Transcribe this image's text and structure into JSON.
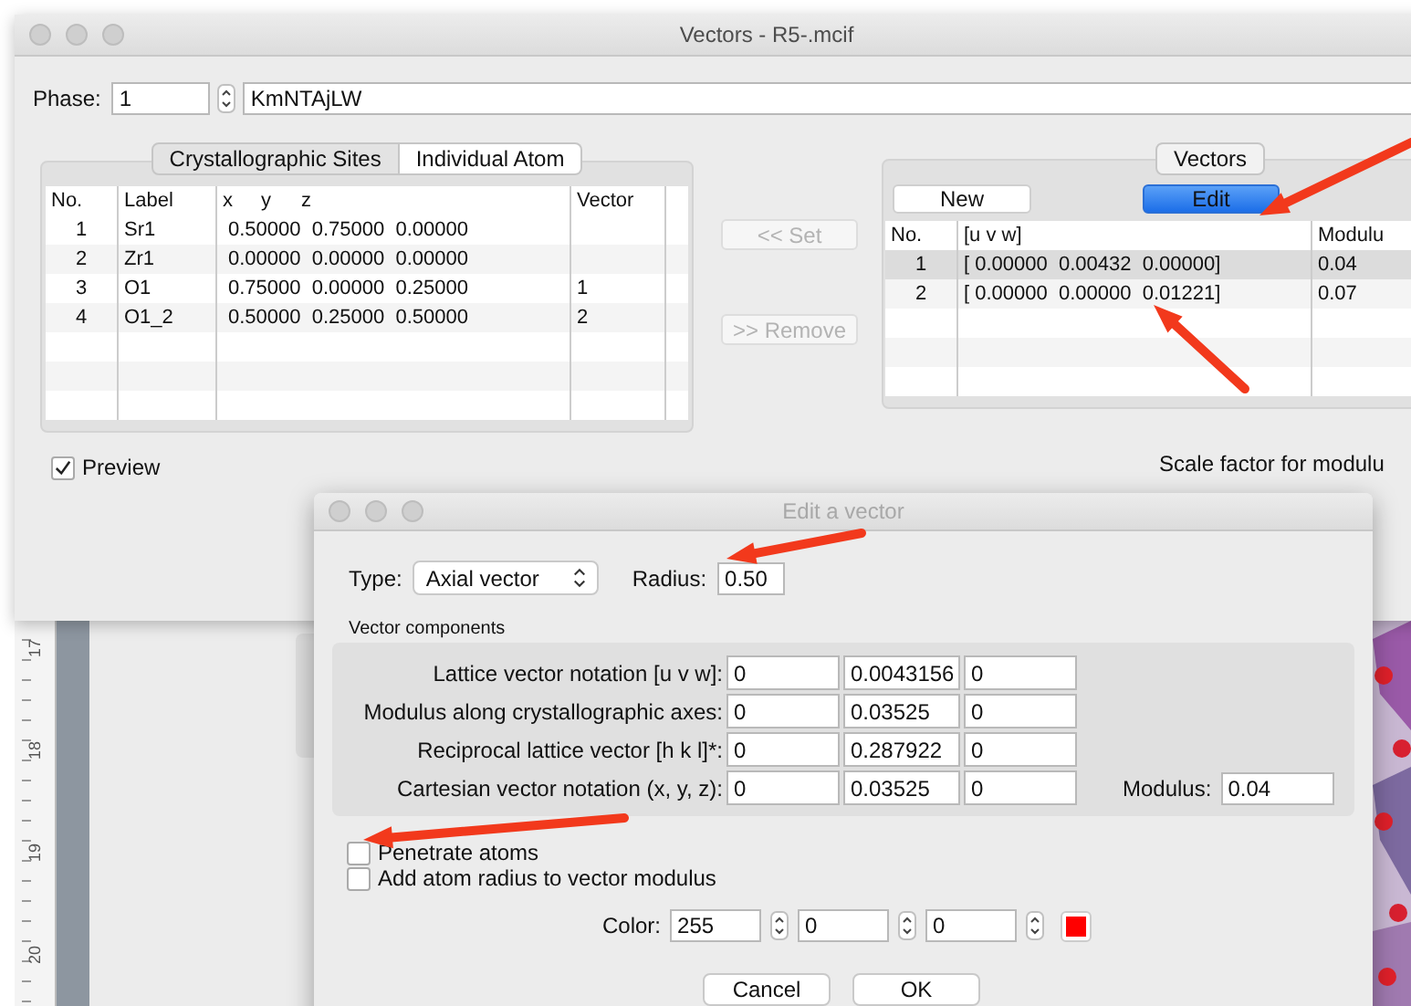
{
  "main_window": {
    "title": "Vectors - R5-.mcif",
    "phase": {
      "label": "Phase:",
      "value": "1",
      "name": "KmNTAjLW"
    },
    "tabs": [
      {
        "label": "Crystallographic Sites",
        "selected": false
      },
      {
        "label": "Individual Atom",
        "selected": true
      }
    ],
    "sites_table": {
      "columns": [
        "No.",
        "Label",
        "x",
        "y",
        "z",
        "Vector"
      ],
      "rows": [
        {
          "no": "1",
          "label": "Sr1",
          "xyz": "0.50000  0.75000  0.00000"
        },
        {
          "no": "2",
          "label": "Zr1",
          "xyz": "0.00000  0.00000  0.00000"
        },
        {
          "no": "3",
          "label": "O1",
          "xyz": "0.75000  0.00000  0.25000",
          "vector": "1"
        },
        {
          "no": "4",
          "label": "O1_2",
          "xyz": "0.50000  0.25000  0.50000",
          "vector": "2"
        }
      ]
    },
    "preview": {
      "label": "Preview",
      "checked": true
    },
    "side_buttons": [
      {
        "label": "<< Set",
        "disabled": true
      },
      {
        "label": ">> Remove",
        "disabled": true
      }
    ],
    "vectors": {
      "tab": "Vectors",
      "buttons": [
        {
          "label": "New",
          "default": false
        },
        {
          "label": "Edit",
          "default": true
        }
      ],
      "columns": [
        "No.",
        "[u v w]",
        "Modulu"
      ],
      "rows": [
        {
          "no": "1",
          "uvw": "[ 0.00000  0.00432  0.00000]",
          "modulus": "0.04",
          "selected": true
        },
        {
          "no": "2",
          "uvw": "[ 0.00000  0.00000  0.01221]",
          "modulus": "0.07",
          "selected": false
        }
      ]
    },
    "scale_label": "Scale factor for modulu"
  },
  "background": {
    "ruler_labels": [
      "17",
      "18",
      "19",
      "20"
    ]
  },
  "dialog": {
    "title": "Edit a vector",
    "type": {
      "label": "Type:",
      "value": "Axial vector"
    },
    "radius": {
      "label": "Radius:",
      "value": "0.50"
    },
    "group_label": "Vector components",
    "rows": [
      {
        "label": "Lattice vector notation [u v w]:",
        "values": [
          "0",
          "0.0043156",
          "0"
        ]
      },
      {
        "label": "Modulus along crystallographic axes:",
        "values": [
          "0",
          "0.03525",
          "0"
        ]
      },
      {
        "label": "Reciprocal lattice vector [h k l]*:",
        "values": [
          "0",
          "0.287922",
          "0"
        ]
      },
      {
        "label": "Cartesian vector notation (x, y, z):",
        "values": [
          "0",
          "0.03525",
          "0"
        ]
      }
    ],
    "modulus": {
      "label": "Modulus:",
      "value": "0.04"
    },
    "checkboxes": [
      {
        "label": "Penetrate atoms",
        "checked": false
      },
      {
        "label": "Add atom radius to vector modulus",
        "checked": false
      }
    ],
    "color": {
      "label": "Color:",
      "values": [
        "255",
        "0",
        "0"
      ]
    },
    "buttons": [
      {
        "label": "Cancel"
      },
      {
        "label": "OK"
      }
    ]
  },
  "annotations": [
    {
      "kind": "arrow"
    },
    {
      "kind": "arrow"
    },
    {
      "kind": "arrow"
    },
    {
      "kind": "arrow"
    }
  ]
}
